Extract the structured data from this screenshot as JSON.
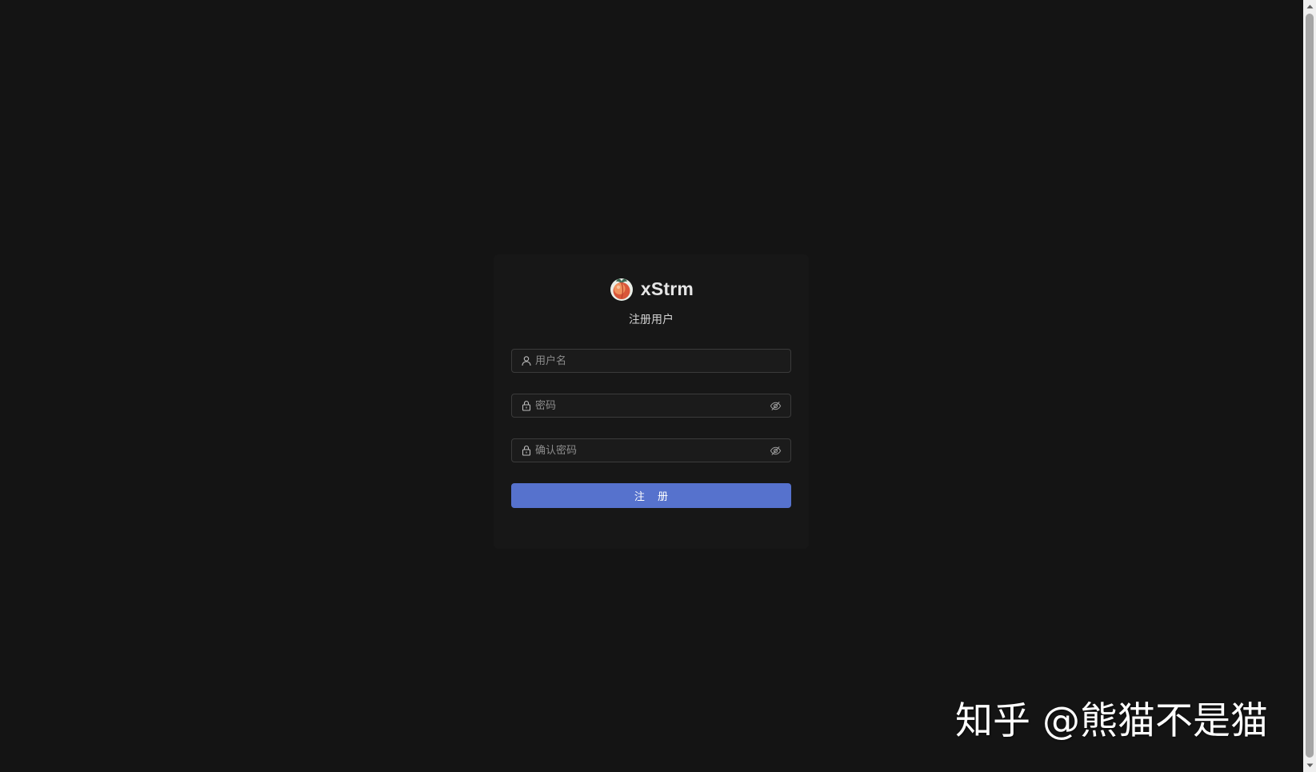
{
  "app": {
    "name": "xStrm"
  },
  "form": {
    "title": "注册用户",
    "username_placeholder": "用户名",
    "password_placeholder": "密码",
    "confirm_placeholder": "确认密码",
    "submit_label": "注 册"
  },
  "icons": {
    "logo": "peach-logo-icon",
    "username": "user-icon",
    "password": "lock-icon",
    "confirm": "lock-icon",
    "visibility": "eye-off-icon"
  },
  "watermark": {
    "text": "知乎 @熊猫不是猫"
  },
  "colors": {
    "page_background": "#141414",
    "card_background": "#171717",
    "primary_button": "#5672cd",
    "input_border": "#3b3b3b",
    "text": "#e6e6e6",
    "placeholder": "#8c8c8c"
  }
}
